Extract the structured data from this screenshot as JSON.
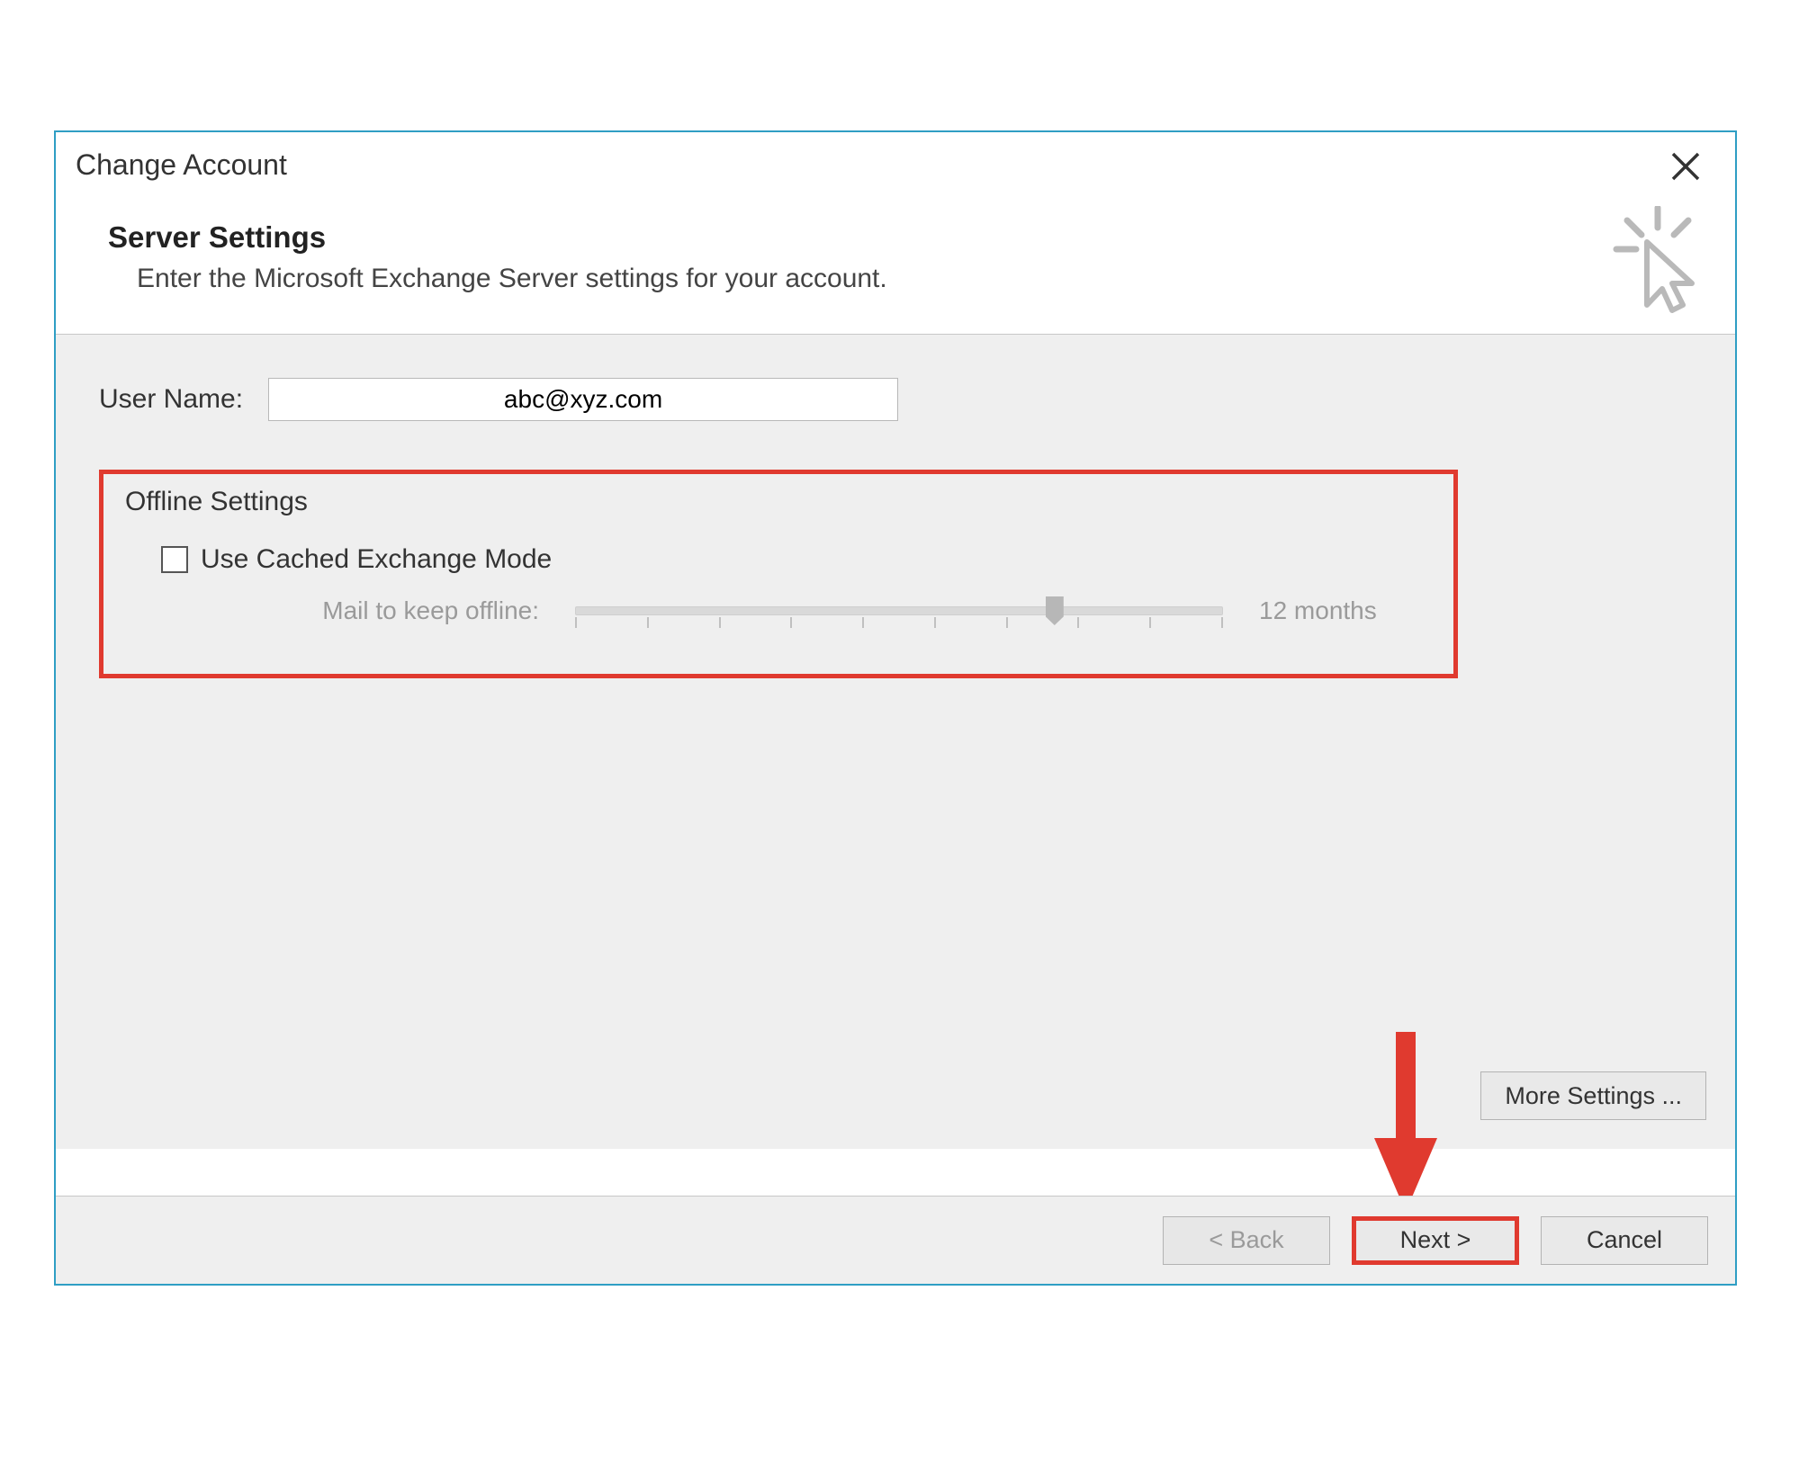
{
  "dialog": {
    "title": "Change Account",
    "heading": "Server Settings",
    "subheading": "Enter the Microsoft Exchange Server settings for your account."
  },
  "user": {
    "label": "User Name:",
    "value": "abc@xyz.com"
  },
  "offline": {
    "group_title": "Offline Settings",
    "cached_label": "Use Cached Exchange Mode",
    "cached_checked": false,
    "slider_label": "Mail to keep offline:",
    "slider_value_label": "12 months"
  },
  "buttons": {
    "more_settings": "More Settings ...",
    "back": "< Back",
    "next": "Next >",
    "cancel": "Cancel"
  }
}
